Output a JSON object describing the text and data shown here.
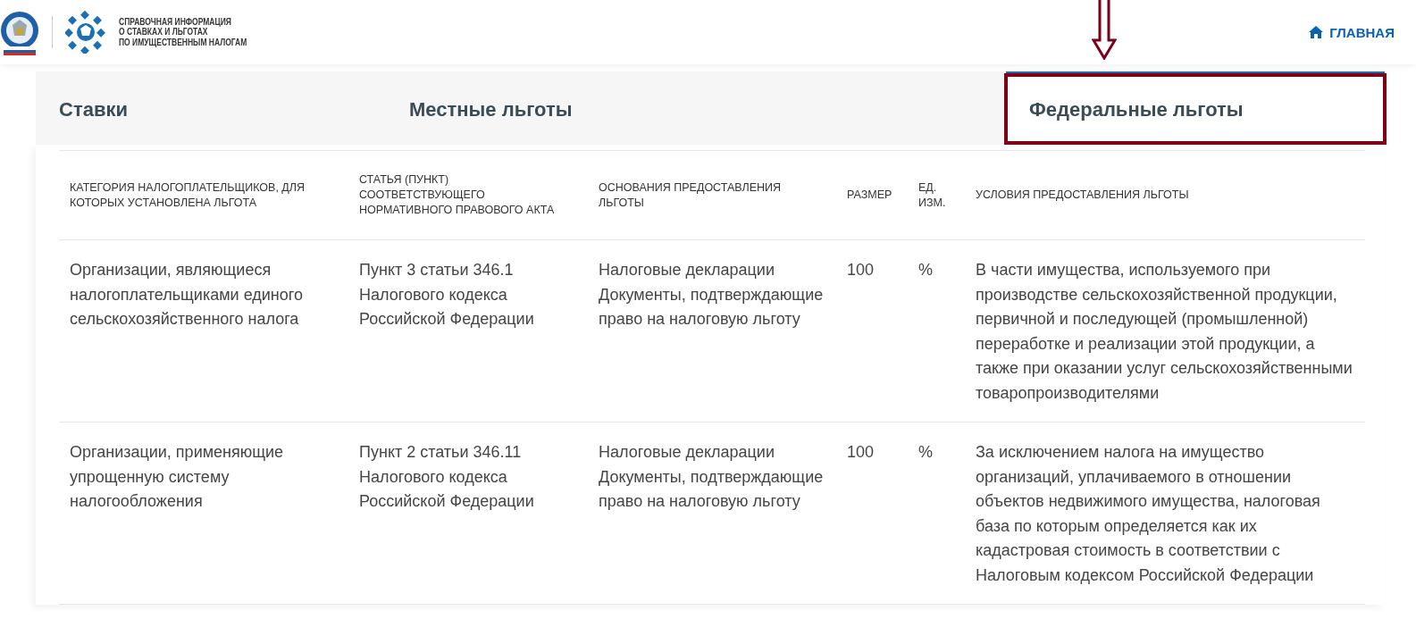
{
  "header": {
    "site_title": [
      "СПРАВОЧНАЯ ИНФОРМАЦИЯ",
      "О СТАВКАХ И ЛЬГОТАХ",
      "ПО ИМУЩЕСТВЕННЫМ НАЛОГАМ"
    ],
    "nav_link": "ГЛАВНАЯ"
  },
  "tabs": [
    {
      "label": "Ставки",
      "selected": false
    },
    {
      "label": "Местные льготы",
      "selected": false
    },
    {
      "label": "Федеральные льготы",
      "selected": true,
      "highlighted": true
    }
  ],
  "table": {
    "columns": [
      "КАТЕГОРИЯ НАЛОГОПЛАТЕЛЬЩИКОВ, ДЛЯ КОТОРЫХ УСТАНОВЛЕНА ЛЬГОТА",
      "СТАТЬЯ (ПУНКТ) СООТВЕТСТВУЮЩЕГО НОРМАТИВНОГО ПРАВОВОГО АКТА",
      "ОСНОВАНИЯ ПРЕДОСТАВЛЕНИЯ ЛЬГОТЫ",
      "РАЗМЕР",
      "ЕД. ИЗМ.",
      "УСЛОВИЯ ПРЕДОСТАВЛЕНИЯ ЛЬГОТЫ"
    ],
    "rows": [
      [
        "Организации, являющиеся налогоплательщиками единого сельскохозяйственного налога",
        "Пункт 3 статьи 346.1 Налогового кодекса Российской Федерации",
        "Налоговые декларации Документы, подтверждающие право на налоговую льготу",
        "100",
        "%",
        "В части имущества, используемого при производстве сельскохозяйственной продукции, первичной и последующей (промышленной) переработке и реализации этой продукции, а также при оказании услуг сельскохозяйственными товаропроизводителями"
      ],
      [
        "Организации, применяющие упрощенную систему налогообложения",
        "Пункт 2 статьи 346.11 Налогового кодекса Российской Федерации",
        "Налоговые декларации Документы, подтверждающие право на налоговую льготу",
        "100",
        "%",
        "За исключением налога на имущество организаций, уплачиваемого в отношении объектов недвижимого имущества, налоговая база по которым определяется как их кадастровая стоимость в соответствии с Налоговым кодексом Российской Федерации"
      ]
    ]
  }
}
